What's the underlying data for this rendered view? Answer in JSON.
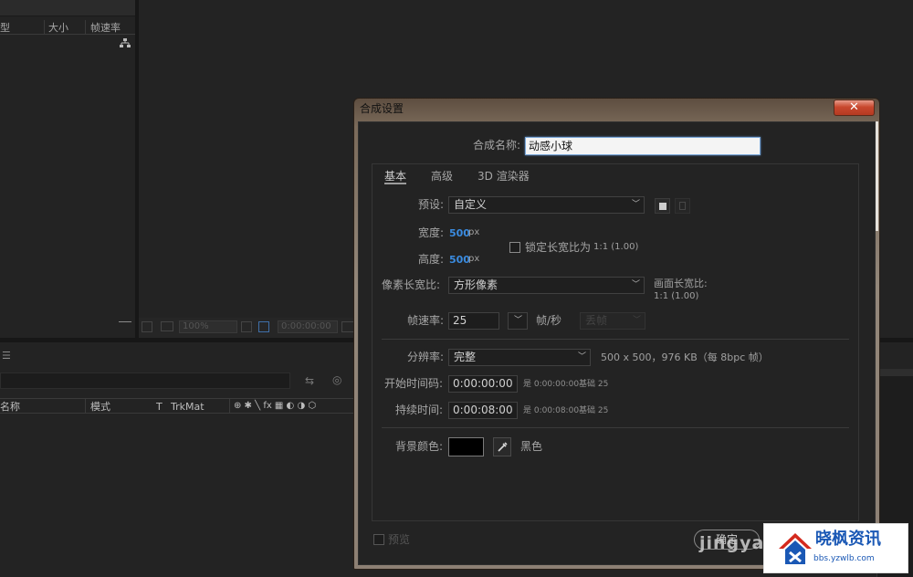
{
  "project_panel": {
    "col_partial": "型",
    "col_size": "大小",
    "col_framerate": "帧速率"
  },
  "viewer_bar": {
    "zoom": "100%",
    "timecode": "0:00:00:00"
  },
  "timeline": {
    "col_name": "名称",
    "col_mode": "模式",
    "col_t": "T",
    "col_trkmat": "TrkMat",
    "switch_icons": "⊕ ✱ ╲ fx ▦ ◐ ◑ ⬡"
  },
  "dialog": {
    "title": "合成设置",
    "close_label": "✕",
    "name_label": "合成名称:",
    "name_value": "动感小球",
    "tabs": [
      "基本",
      "高级",
      "3D 渲染器"
    ],
    "preset_label": "预设:",
    "preset_value": "自定义",
    "width_label": "宽度:",
    "width_value": "500",
    "width_unit": "px",
    "height_label": "高度:",
    "height_value": "500",
    "height_unit": "px",
    "lock_aspect_label": "锁定长宽比为",
    "lock_aspect_value": "1:1 (1.00)",
    "pixel_aspect_label": "像素长宽比:",
    "pixel_aspect_value": "方形像素",
    "frame_aspect_label": "画面长宽比:",
    "frame_aspect_value": "1:1 (1.00)",
    "framerate_label": "帧速率:",
    "framerate_value": "25",
    "framerate_unit": "帧/秒",
    "drop_frame_value": "丢帧",
    "resolution_label": "分辨率:",
    "resolution_value": "完整",
    "resolution_info": "500 x 500，976 KB（每 8bpc 帧）",
    "start_tc_label": "开始时间码:",
    "start_tc_value": "0:00:00:00",
    "start_tc_is": "是 0:00:00:00",
    "start_tc_base": "基础 25",
    "duration_label": "持续时间:",
    "duration_value": "0:00:08:00",
    "duration_is": "是 0:00:08:00",
    "duration_base": "基础 25",
    "bg_label": "背景颜色:",
    "bg_color_name": "黑色",
    "bg_color": "#000000",
    "preview_label": "预览",
    "ok_label": "确定"
  },
  "watermark": {
    "text": "jingyan",
    "logo_title": "晓枫资讯",
    "logo_url": "bbs.yzwlb.com"
  }
}
